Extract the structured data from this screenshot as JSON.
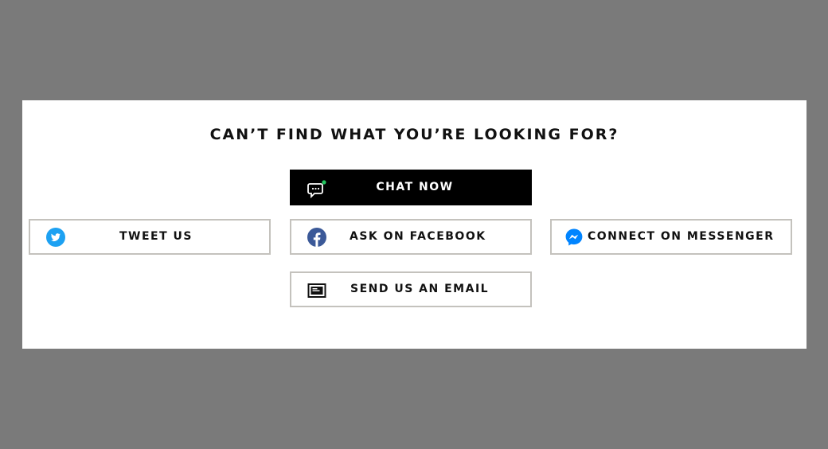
{
  "contact": {
    "heading": "CAN’T FIND WHAT YOU’RE LOOKING FOR?",
    "buttons": {
      "chat": {
        "label": "CHAT NOW",
        "icon": "chat-bubble-icon",
        "status_color": "#22c55e"
      },
      "tweet": {
        "label": "TWEET US",
        "icon": "twitter-icon",
        "color": "#1da1f2"
      },
      "facebook": {
        "label": "ASK ON FACEBOOK",
        "icon": "facebook-icon",
        "color": "#3b5998"
      },
      "messenger": {
        "label": "CONNECT ON MESSENGER",
        "icon": "messenger-icon",
        "color": "#0084ff"
      },
      "email": {
        "label": "SEND US AN EMAIL",
        "icon": "email-icon"
      }
    }
  }
}
